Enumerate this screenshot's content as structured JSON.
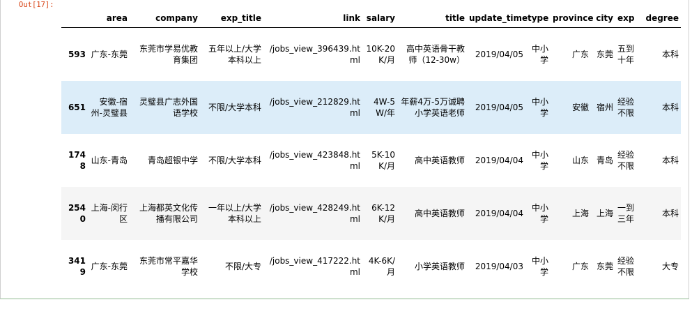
{
  "prompt": "Out[17]:",
  "columns": [
    "",
    "area",
    "company",
    "exp_title",
    "link",
    "salary",
    "title",
    "update_time",
    "type",
    "province",
    "city",
    "exp",
    "degree"
  ],
  "rows": [
    {
      "index": "593",
      "area": "广东-东莞",
      "company": "东莞市学易优教育集团",
      "exp_title": "五年以上/大学本科以上",
      "link": "/jobs_view_396439.html",
      "salary": "10K-20K/月",
      "title": "高中英语骨干教师（12-30w）",
      "update_time": "2019/04/05",
      "type": "中小学",
      "province": "广东",
      "city": "东莞",
      "exp": "五到十年",
      "degree": "本科"
    },
    {
      "index": "651",
      "area": "安徽-宿州-灵璧县",
      "company": "灵璧县广志外国语学校",
      "exp_title": "不限/大学本科",
      "link": "/jobs_view_212829.html",
      "salary": "4W-5W/年",
      "title": "年薪4万-5万诚聘小学英语老师",
      "update_time": "2019/04/05",
      "type": "中小学",
      "province": "安徽",
      "city": "宿州",
      "exp": "经验不限",
      "degree": "本科"
    },
    {
      "index": "1748",
      "area": "山东-青岛",
      "company": "青岛超银中学",
      "exp_title": "不限/大学本科",
      "link": "/jobs_view_423848.html",
      "salary": "5K-10K/月",
      "title": "高中英语教师",
      "update_time": "2019/04/04",
      "type": "中小学",
      "province": "山东",
      "city": "青岛",
      "exp": "经验不限",
      "degree": "本科"
    },
    {
      "index": "2540",
      "area": "上海-闵行区",
      "company": "上海都英文化传播有限公司",
      "exp_title": "一年以上/大学本科以上",
      "link": "/jobs_view_428249.html",
      "salary": "6K-12K/月",
      "title": "高中英语教师",
      "update_time": "2019/04/04",
      "type": "中小学",
      "province": "上海",
      "city": "上海",
      "exp": "一到三年",
      "degree": "本科"
    },
    {
      "index": "3419",
      "area": "广东-东莞",
      "company": "东莞市常平嘉华学校",
      "exp_title": "不限/大专",
      "link": "/jobs_view_417222.html",
      "salary": "4K-6K/月",
      "title": "小学英语教师",
      "update_time": "2019/04/03",
      "type": "中小学",
      "province": "广东",
      "city": "东莞",
      "exp": "经验不限",
      "degree": "大专"
    }
  ]
}
